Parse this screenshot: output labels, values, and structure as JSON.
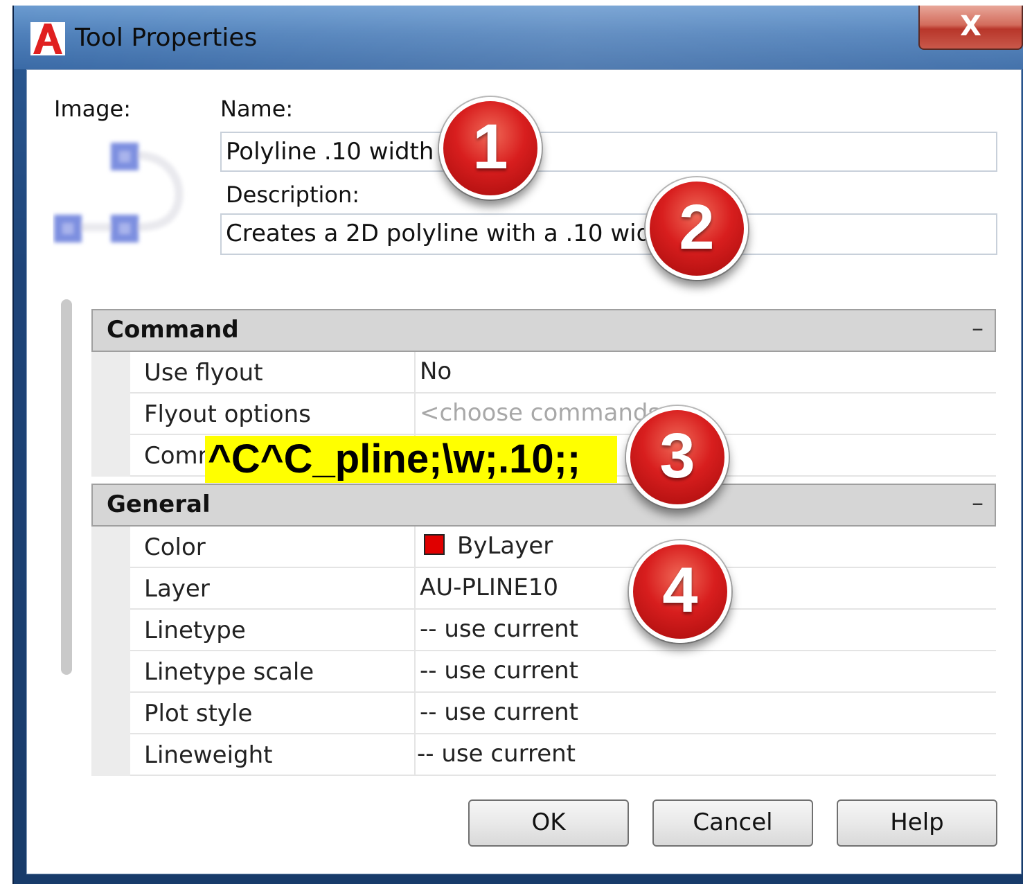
{
  "window": {
    "title": "Tool Properties",
    "close_glyph": "X"
  },
  "form": {
    "image_label": "Image:",
    "name_label": "Name:",
    "name_value": "Polyline .10 width",
    "description_label": "Description:",
    "description_value": "Creates a 2D polyline with a .10 width"
  },
  "properties": {
    "command": {
      "title": "Command",
      "collapse_glyph": "–",
      "rows": [
        {
          "name": "Use flyout",
          "value": "No"
        },
        {
          "name": "Flyout options",
          "value": "<choose commands>"
        },
        {
          "name": "Comr",
          "value": ""
        }
      ]
    },
    "general": {
      "title": "General",
      "collapse_glyph": "–",
      "rows": [
        {
          "name": "Color",
          "value": "ByLayer",
          "swatch": "#e00000"
        },
        {
          "name": "Layer",
          "value": "AU-PLINE10"
        },
        {
          "name": "Linetype",
          "value": "-- use current"
        },
        {
          "name": "Linetype scale",
          "value": "-- use current"
        },
        {
          "name": "Plot style",
          "value": "-- use current"
        },
        {
          "name": "Lineweight",
          "value": "-- use current"
        }
      ]
    }
  },
  "highlight": {
    "macro": "^C^C_pline;\\w;.10;;"
  },
  "callouts": [
    "1",
    "2",
    "3",
    "4"
  ],
  "buttons": {
    "ok": "OK",
    "cancel": "Cancel",
    "help": "Help"
  },
  "colors": {
    "title_bar": "#4f80ba",
    "highlight": "#ffff00",
    "callout": "#d81e1e",
    "swatch": "#e00000"
  }
}
